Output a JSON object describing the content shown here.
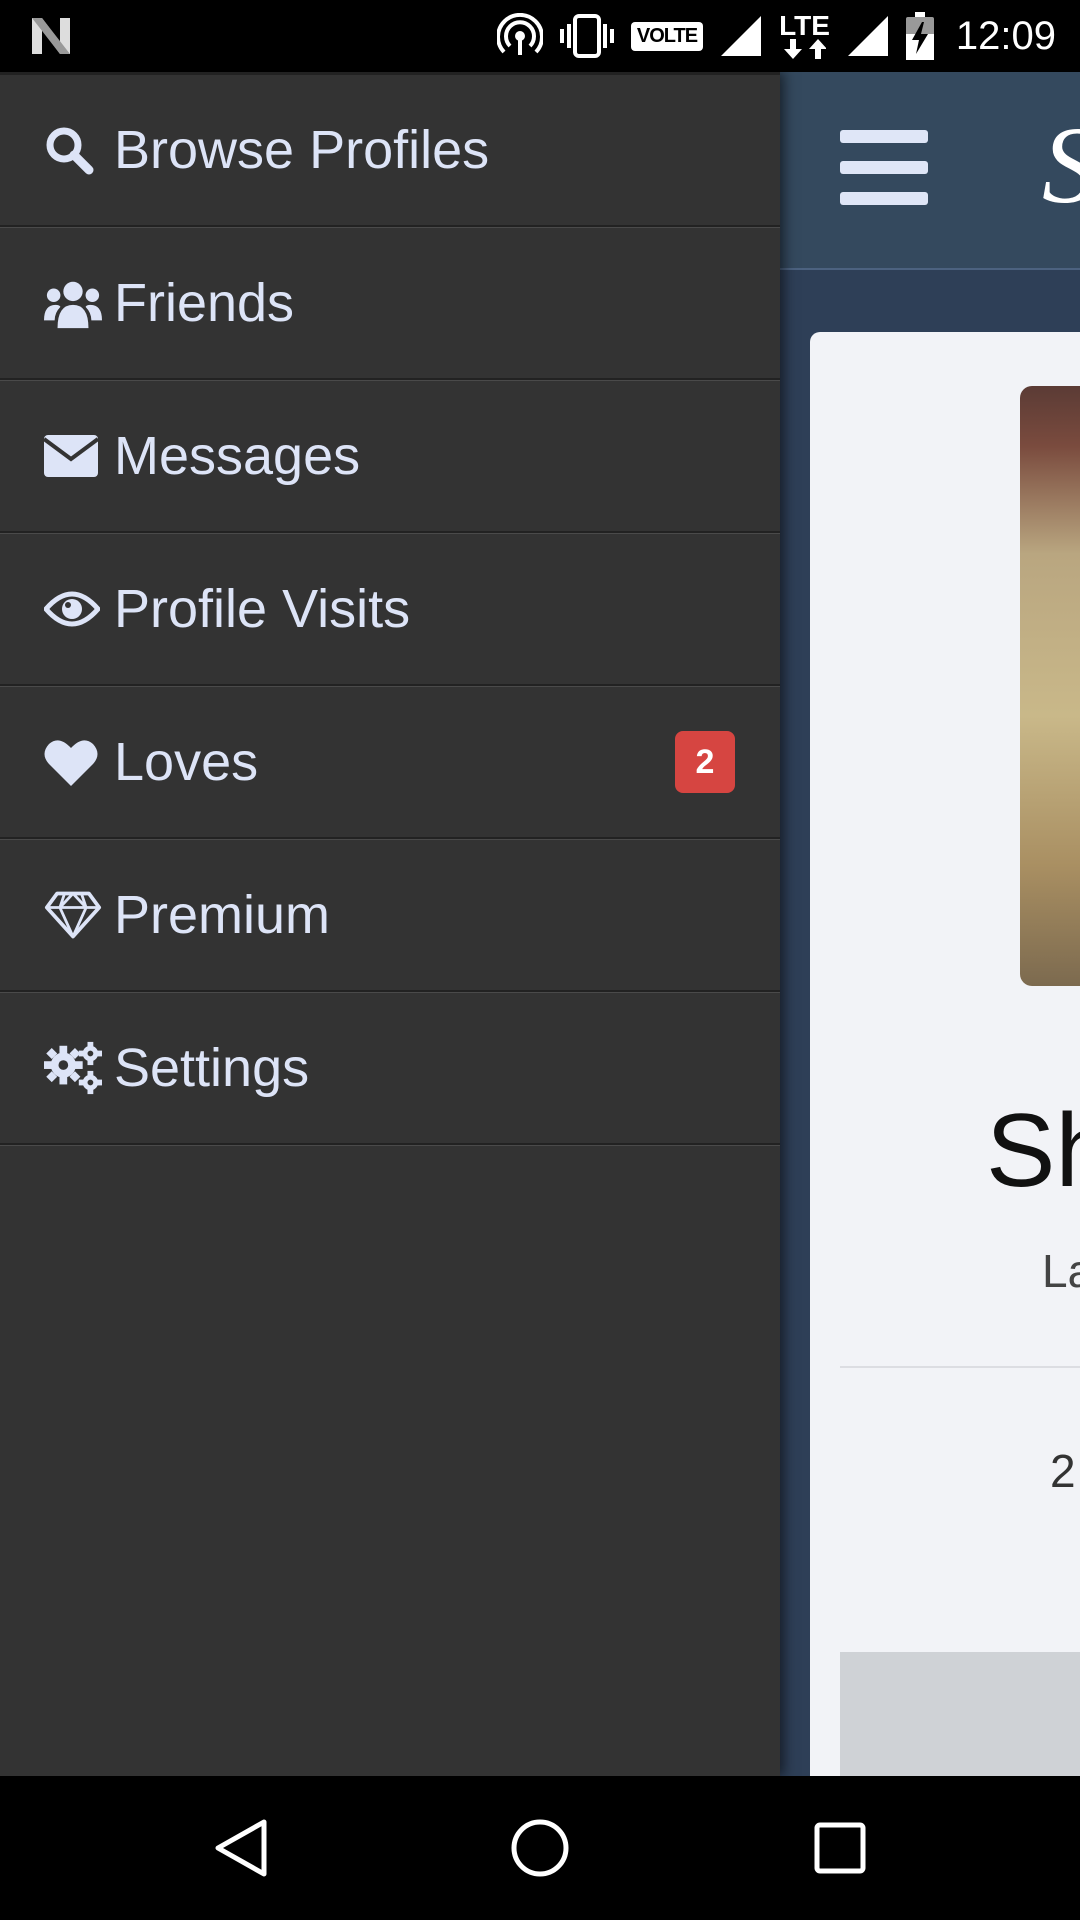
{
  "status_bar": {
    "time": "12:09",
    "volte": "VOLTE",
    "lte": "LTE",
    "icons": [
      "n-logo-icon",
      "hotspot-icon",
      "vibrate-icon",
      "volte-icon",
      "signal-icon",
      "lte-icon",
      "signal-icon",
      "battery-charging-icon"
    ]
  },
  "drawer": {
    "items": [
      {
        "label": "Browse Profiles",
        "icon": "search-icon"
      },
      {
        "label": "Friends",
        "icon": "users-icon"
      },
      {
        "label": "Messages",
        "icon": "envelope-icon"
      },
      {
        "label": "Profile Visits",
        "icon": "eye-icon"
      },
      {
        "label": "Loves",
        "icon": "heart-icon",
        "badge": "2"
      },
      {
        "label": "Premium",
        "icon": "diamond-icon"
      },
      {
        "label": "Settings",
        "icon": "gears-icon"
      }
    ]
  },
  "background_page": {
    "logo_partial": "S",
    "name_partial": "Sh",
    "subtitle_partial": "La",
    "stat_partial": "2"
  },
  "colors": {
    "drawer_bg": "#333333",
    "menu_text": "#dde4f7",
    "badge": "#d64541",
    "app_header": "#34495e"
  },
  "nav_bar": {
    "buttons": [
      "back-icon",
      "home-icon",
      "recents-icon"
    ]
  }
}
